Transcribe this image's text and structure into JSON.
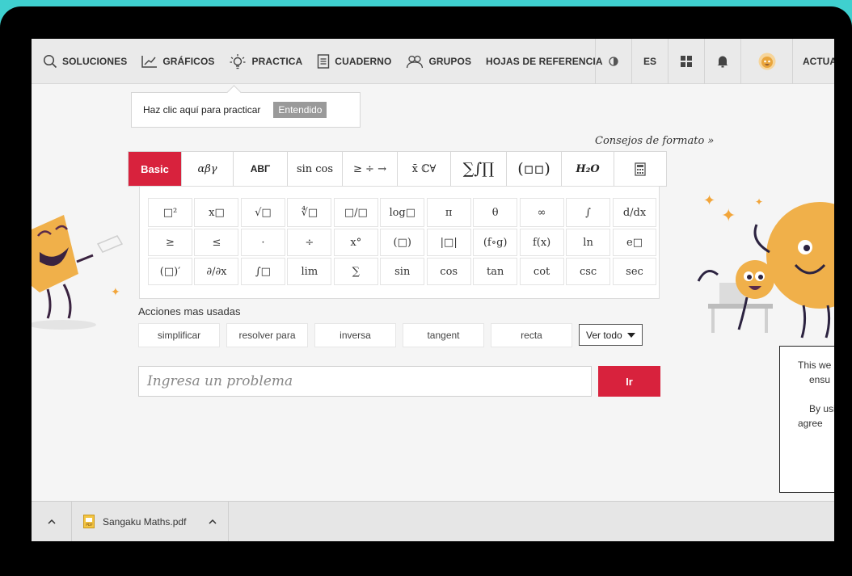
{
  "nav": {
    "items": [
      {
        "label": "SOLUCIONES",
        "icon": "search-icon"
      },
      {
        "label": "GRÁFICOS",
        "icon": "graph-icon"
      },
      {
        "label": "PRACTICA",
        "icon": "lightbulb-icon"
      },
      {
        "label": "CUADERNO",
        "icon": "notebook-icon"
      },
      {
        "label": "GRUPOS",
        "icon": "users-icon"
      },
      {
        "label": "HOJAS DE REFERENCIA",
        "icon": ""
      }
    ],
    "language": "ES",
    "account": "ACTUAL"
  },
  "tooltip": {
    "text": "Haz clic aquí para practicar",
    "button": "Entendido"
  },
  "consejos": "Consejos de formato »",
  "tabs": [
    "Basic",
    "αβγ",
    "ΑΒΓ",
    "sin cos",
    "≥ ÷ →",
    "x̄ ℂ∀",
    "∑∫∏",
    "(▫▫)",
    "H₂O",
    "calculator"
  ],
  "keypad": {
    "rows": [
      [
        "□²",
        "x□",
        "√□",
        "∜□",
        "□/□",
        "log□",
        "π",
        "θ",
        "∞",
        "∫",
        "d/dx"
      ],
      [
        "≥",
        "≤",
        "·",
        "÷",
        "x°",
        "(□)",
        "|□|",
        "(f∘g)",
        "f(x)",
        "ln",
        "e□"
      ],
      [
        "(□)′",
        "∂/∂x",
        "∫□",
        "lim",
        "∑",
        "sin",
        "cos",
        "tan",
        "cot",
        "csc",
        "sec"
      ]
    ]
  },
  "acciones": {
    "title": "Acciones mas usadas",
    "items": [
      "simplificar",
      "resolver para",
      "inversa",
      "tangent",
      "recta"
    ],
    "ver_todo": "Ver todo"
  },
  "problem": {
    "placeholder": "Ingresa un problema",
    "submit": "Ir"
  },
  "cookie": {
    "lines": [
      "This we",
      "ensu",
      "",
      "By usi",
      "agree"
    ]
  },
  "download": {
    "filename": "Sangaku Maths.pdf"
  },
  "colors": {
    "accent": "#d8223d",
    "border": "#3fd0cf",
    "mascot": "#f0b04a"
  }
}
